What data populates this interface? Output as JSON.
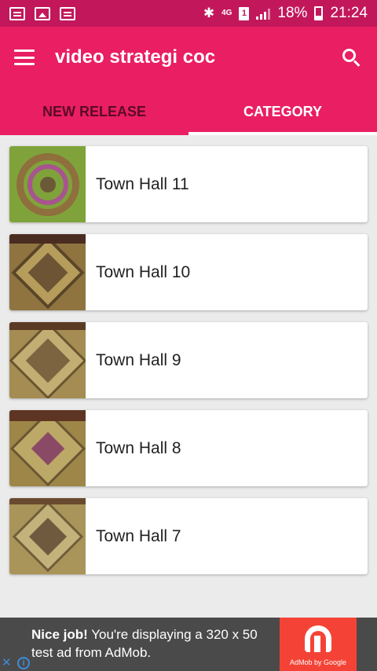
{
  "status_bar": {
    "time": "21:24",
    "battery_percent": "18%",
    "network": "4G",
    "sim": "1",
    "icons": [
      "bbm-icon",
      "gallery-icon",
      "messenger-icon",
      "bluetooth-icon",
      "signal-icon",
      "battery-icon"
    ]
  },
  "toolbar": {
    "title": "video strategi coc",
    "menu_icon": "hamburger-menu-icon",
    "search_icon": "search-icon"
  },
  "tabs": [
    {
      "label": "NEW RELEASE",
      "selected": false
    },
    {
      "label": "CATEGORY",
      "selected": true
    }
  ],
  "list": {
    "items": [
      {
        "label": "Town Hall 11",
        "thumbnail": "th11-base-thumbnail"
      },
      {
        "label": "Town Hall 10",
        "thumbnail": "th10-base-thumbnail"
      },
      {
        "label": "Town Hall 9",
        "thumbnail": "th9-base-thumbnail"
      },
      {
        "label": "Town Hall 8",
        "thumbnail": "th8-base-thumbnail"
      },
      {
        "label": "Town Hall 7",
        "thumbnail": "th7-base-thumbnail"
      }
    ]
  },
  "ad": {
    "headline": "Nice job!",
    "body": " You're displaying a 320 x 50 test ad from AdMob.",
    "brand": "AdMob by Google"
  },
  "colors": {
    "status_bar": "#c2185b",
    "primary": "#e91e63",
    "inactive_tab_text": "#5c0b25",
    "background": "#ebebeb",
    "ad_background": "#4a4a4a",
    "ad_logo": "#f44336"
  }
}
